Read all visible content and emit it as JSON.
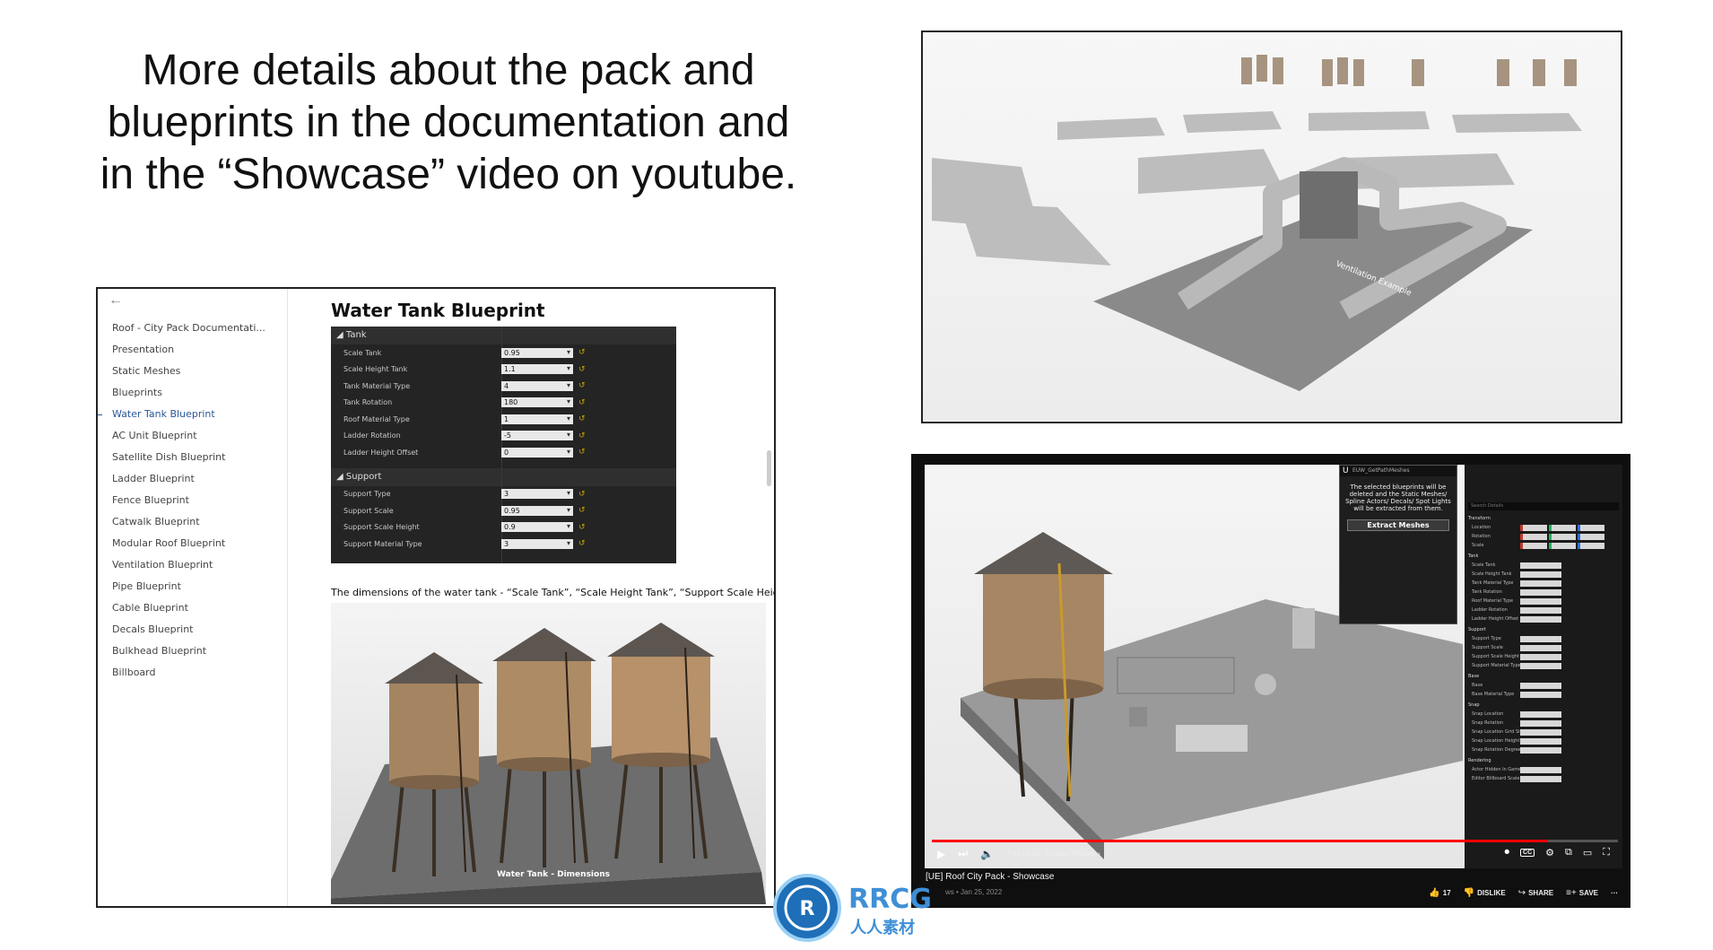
{
  "headline": {
    "line1": "More details about the pack and",
    "line2": "blueprints in the documentation and",
    "line3": "in the “Showcase” video on youtube."
  },
  "doc": {
    "back_icon": "arrow-left-icon",
    "nav": [
      "Roof - City Pack Documentati...",
      "Presentation",
      "Static Meshes",
      "Blueprints",
      "Water Tank Blueprint",
      "AC Unit Blueprint",
      "Satellite Dish Blueprint",
      "Ladder Blueprint",
      "Fence Blueprint",
      "Catwalk Blueprint",
      "Modular Roof Blueprint",
      "Ventilation Blueprint",
      "Pipe Blueprint",
      "Cable Blueprint",
      "Decals Blueprint",
      "Bulkhead Blueprint",
      "Billboard"
    ],
    "active_index": 4,
    "title": "Water Tank Blueprint",
    "props": {
      "tank_section": "Tank",
      "tank_rows": [
        {
          "label": "Scale Tank",
          "value": "0.95"
        },
        {
          "label": "Scale Height Tank",
          "value": "1.1"
        },
        {
          "label": "Tank Material Type",
          "value": "4"
        },
        {
          "label": "Tank Rotation",
          "value": "180"
        },
        {
          "label": "Roof Material Type",
          "value": "1"
        },
        {
          "label": "Ladder Rotation",
          "value": "-5"
        },
        {
          "label": "Ladder Height Offset",
          "value": "0"
        }
      ],
      "support_section": "Support",
      "support_rows": [
        {
          "label": "Support Type",
          "value": "3"
        },
        {
          "label": "Support Scale",
          "value": "0.95"
        },
        {
          "label": "Support Scale Height",
          "value": "0.9"
        },
        {
          "label": "Support Material Type",
          "value": "3"
        }
      ]
    },
    "caption": "The dimensions of the water tank - “Scale Tank”, “Scale Height Tank”, “Support Scale Height”",
    "image_label": "Water Tank - Dimensions"
  },
  "render": {
    "label": "Ventilation Example"
  },
  "video": {
    "popup": {
      "title": "EUW_GetPathMeshes",
      "message": "The selected blueprints will be deleted and the Static Meshes/ Spline Actors/ Decals/ Spot Lights will be extracted from them.",
      "button": "Extract Meshes"
    },
    "details": {
      "search_placeholder": "Search Details",
      "sections": [
        "Transform",
        "Tank",
        "Support",
        "Base",
        "Snap",
        "Rendering"
      ],
      "transform_rows": [
        "Location",
        "Rotation",
        "Scale"
      ],
      "tank_rows": [
        "Scale Tank",
        "Scale Height Tank",
        "Tank Material Type",
        "Tank Rotation",
        "Roof Material Type",
        "Ladder Rotation",
        "Ladder Height Offset"
      ],
      "support_rows": [
        "Support Type",
        "Support Scale",
        "Support Scale Height",
        "Support Material Type"
      ],
      "base_rows": [
        "Base",
        "Base Material Type"
      ],
      "snap_rows": [
        "Snap Location",
        "Snap Rotation",
        "Snap Location Grid Size",
        "Snap Location Height Size",
        "Snap Rotation Degrees"
      ],
      "rendering_rows": [
        "Actor Hidden In Game",
        "Editor Billboard Scale"
      ]
    },
    "time": "7:56 / 8:50",
    "chapter": "Extract Meshes",
    "progress": 0.898,
    "title": "[UE] Roof City Pack - Showcase",
    "meta": "ws • Jan 25, 2022",
    "likes": "17",
    "dislike_label": "DISLIKE",
    "share_label": "SHARE",
    "save_label": "SAVE",
    "cc_label": "CC"
  },
  "watermark": {
    "brand": "RRCG",
    "sub": "人人素材"
  }
}
